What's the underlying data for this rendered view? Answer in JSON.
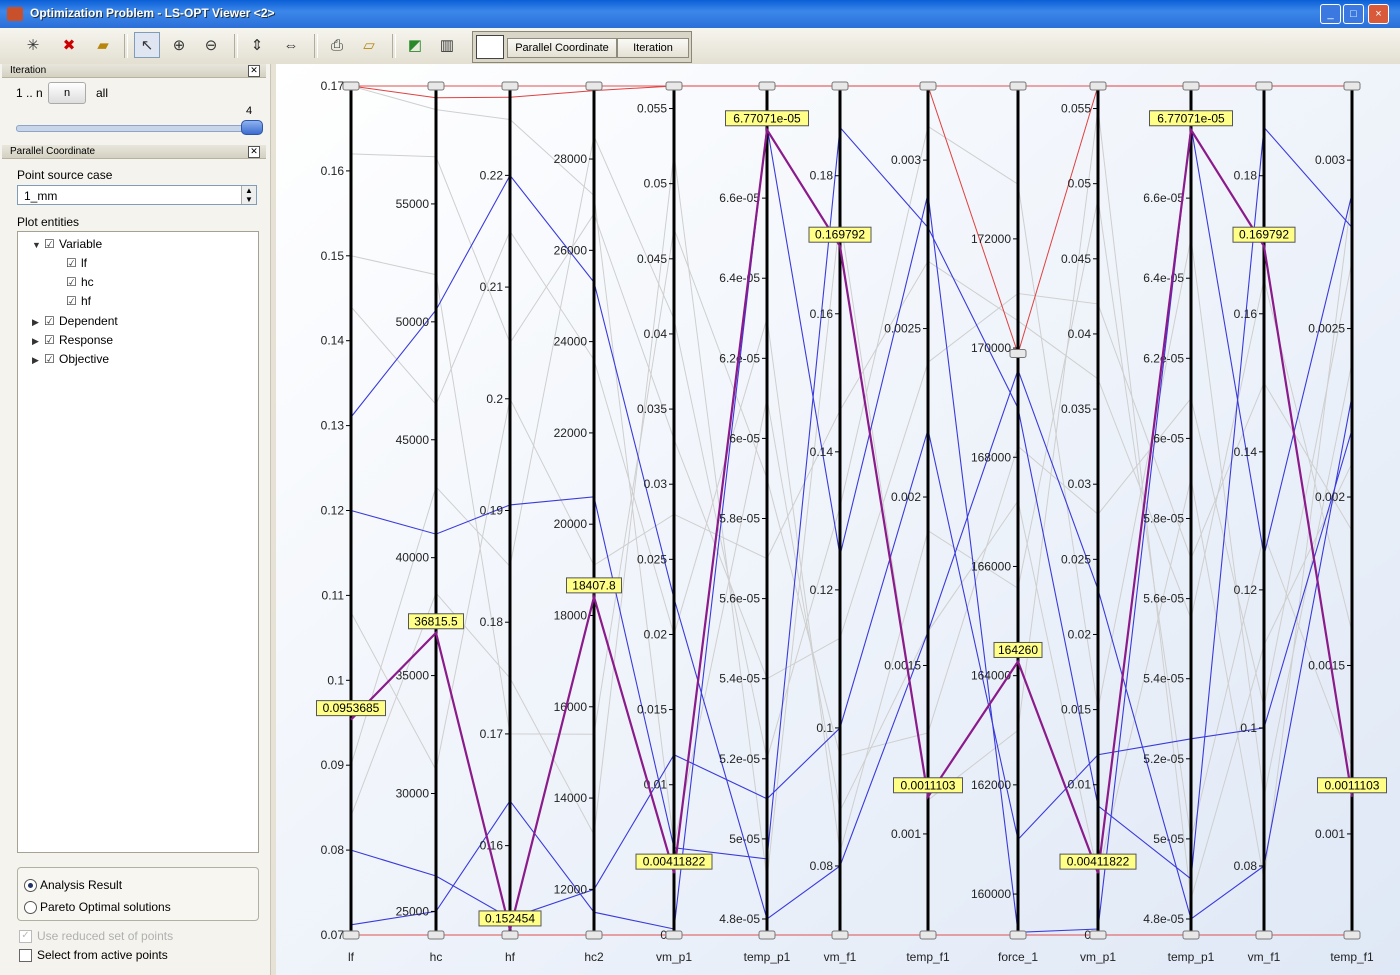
{
  "window": {
    "title": "Optimization Problem - LS-OPT Viewer <2>",
    "buttons": [
      "_",
      "□",
      "×"
    ]
  },
  "toolbar": {
    "icons": [
      "new-plot-icon",
      "delete-plot-icon",
      "open-folder-icon",
      "pointer-icon",
      "zoom-in-icon",
      "zoom-out-icon",
      "expand-vertical-icon",
      "expand-horizontal-icon",
      "print-icon",
      "export-icon",
      "plot-settings-icon",
      "layout-icon"
    ],
    "tabs": [
      "Parallel Coordinate",
      "Iteration"
    ]
  },
  "iteration_panel": {
    "title": "Iteration",
    "range_label": "1 .. n",
    "n_button": "n",
    "all_label": "all",
    "slider_value": "4",
    "slider_fraction": 1.0
  },
  "pc_panel": {
    "title": "Parallel Coordinate",
    "point_source_label": "Point source case",
    "point_source_value": "1_mm",
    "plot_entities_label": "Plot entities",
    "tree": [
      {
        "label": "Variable",
        "expanded": true,
        "checked": true,
        "children": [
          "lf",
          "hc",
          "hf"
        ]
      },
      {
        "label": "Dependent",
        "expanded": false,
        "checked": true
      },
      {
        "label": "Response",
        "expanded": false,
        "checked": true
      },
      {
        "label": "Objective",
        "expanded": false,
        "checked": true
      }
    ],
    "radio_options": [
      "Analysis Result",
      "Pareto Optimal solutions"
    ],
    "radio_selected": 0,
    "checkbox_reduced": "Use reduced set of points",
    "checkbox_active": "Select from active points"
  },
  "colors": {
    "selected": "#8b1a8b",
    "feasible": "#3a3adb",
    "infeasible": "#cfcfcf",
    "highlight": "#e04040",
    "label_bg": "#ffff88"
  },
  "chart_data": {
    "type": "parallel-coordinates",
    "axes": [
      {
        "name": "lf",
        "range": [
          0.07,
          0.17
        ],
        "ticks": [
          "0.07",
          "0.08",
          "0.09",
          "0.1",
          "0.11",
          "0.12",
          "0.13",
          "0.14",
          "0.15",
          "0.16",
          "0.17"
        ]
      },
      {
        "name": "hc",
        "range": [
          24000,
          60000
        ],
        "ticks": [
          "25000",
          "30000",
          "35000",
          "40000",
          "45000",
          "50000",
          "55000"
        ]
      },
      {
        "name": "hf",
        "range": [
          0.152,
          0.228
        ],
        "ticks": [
          "0.16",
          "0.17",
          "0.18",
          "0.19",
          "0.2",
          "0.21",
          "0.22"
        ]
      },
      {
        "name": "hc2",
        "range": [
          11000,
          29600
        ],
        "ticks": [
          "12000",
          "14000",
          "16000",
          "18000",
          "20000",
          "22000",
          "24000",
          "26000",
          "28000"
        ]
      },
      {
        "name": "vm_p1",
        "range": [
          0,
          0.0565
        ],
        "ticks": [
          "0",
          "0.005",
          "0.01",
          "0.015",
          "0.02",
          "0.025",
          "0.03",
          "0.035",
          "0.04",
          "0.045",
          "0.05",
          "0.055"
        ]
      },
      {
        "name": "temp_p1",
        "range": [
          4.76e-05,
          6.88e-05
        ],
        "ticks": [
          "4.8e-05",
          "5e-05",
          "5.2e-05",
          "5.4e-05",
          "5.6e-05",
          "5.8e-05",
          "6e-05",
          "6.2e-05",
          "6.4e-05",
          "6.6e-05"
        ]
      },
      {
        "name": "vm_f1",
        "range": [
          0.07,
          0.193
        ],
        "ticks": [
          "0.08",
          "0.1",
          "0.12",
          "0.14",
          "0.16",
          "0.18"
        ]
      },
      {
        "name": "temp_f1",
        "range": [
          0.0007,
          0.00322
        ],
        "ticks": [
          "0.001",
          "0.0015",
          "0.002",
          "0.0025",
          "0.003"
        ]
      },
      {
        "name": "force_1",
        "range": [
          159250,
          174800
        ],
        "ticks": [
          "160000",
          "162000",
          "164000",
          "166000",
          "168000",
          "170000",
          "172000"
        ]
      },
      {
        "name": "vm_p1",
        "range": [
          0,
          0.0565
        ],
        "ticks": [
          "0",
          "0.005",
          "0.01",
          "0.015",
          "0.02",
          "0.025",
          "0.03",
          "0.035",
          "0.04",
          "0.045",
          "0.05",
          "0.055"
        ]
      },
      {
        "name": "temp_p1",
        "range": [
          4.76e-05,
          6.88e-05
        ],
        "ticks": [
          "4.8e-05",
          "5e-05",
          "5.2e-05",
          "5.4e-05",
          "5.6e-05",
          "5.8e-05",
          "6e-05",
          "6.2e-05",
          "6.4e-05",
          "6.6e-05"
        ]
      },
      {
        "name": "vm_f1",
        "range": [
          0.07,
          0.193
        ],
        "ticks": [
          "0.08",
          "0.1",
          "0.12",
          "0.14",
          "0.16",
          "0.18"
        ]
      },
      {
        "name": "temp_f1",
        "range": [
          0.0007,
          0.00322
        ],
        "ticks": [
          "0.001",
          "0.0015",
          "0.002",
          "0.0025",
          "0.003"
        ]
      }
    ],
    "selected_point": {
      "values": [
        0.0953685,
        36815.5,
        0.152454,
        18407.8,
        0.00411822,
        6.77071e-05,
        0.169792,
        0.0011103,
        164260,
        0.00411822,
        6.77071e-05,
        0.169792,
        0.0011103
      ],
      "labels": [
        "0.0953685",
        "36815.5",
        "0.152454",
        "18407.8",
        "0.00411822",
        "6.77071e-05",
        "0.169792",
        "0.0011103",
        "164260",
        "0.00411822",
        "6.77071e-05",
        "0.169792",
        "0.0011103"
      ]
    },
    "feasible_points": [
      [
        0.12,
        41000,
        0.1905,
        20600,
        0.0058,
        4.95e-05,
        0.187,
        0.0028,
        168900,
        0.0086,
        4.9e-05,
        0.187,
        0.0028
      ],
      [
        0.131,
        50500,
        0.22,
        25300,
        0.0224,
        4.8e-05,
        0.08,
        0.0016,
        169600,
        0.023,
        4.8e-05,
        0.08,
        0.0023
      ],
      [
        0.0712,
        25000,
        0.164,
        11500,
        0.0004,
        6.78e-05,
        0.125,
        0.0029,
        159300,
        0.0004,
        6.78e-05,
        0.125,
        0.0029
      ],
      [
        0.08,
        26500,
        0.1535,
        12000,
        0.012,
        5.1e-05,
        0.1,
        0.0022,
        161000,
        0.012,
        5.25e-05,
        0.1,
        0.0022
      ]
    ],
    "infeasible_points": [
      [
        0.162,
        57000,
        0.205,
        26800,
        0.033,
        5.4e-05,
        0.113,
        0.0024,
        171000,
        0.042,
        5.7e-05,
        0.15,
        0.0019
      ],
      [
        0.15,
        52000,
        0.17,
        15400,
        0.047,
        5.9e-05,
        0.096,
        0.0013,
        168200,
        0.028,
        6.1e-05,
        0.103,
        0.0027
      ],
      [
        0.144,
        46500,
        0.215,
        23600,
        0.02,
        6.3e-05,
        0.082,
        0.0019,
        165600,
        0.049,
        5e-05,
        0.128,
        0.0012
      ],
      [
        0.09,
        43000,
        0.185,
        28500,
        0.041,
        5.2e-05,
        0.132,
        0.0031,
        173000,
        0.015,
        6.5e-05,
        0.09,
        0.0024
      ],
      [
        0.108,
        31000,
        0.2,
        19100,
        0.028,
        5.7e-05,
        0.146,
        0.0027,
        170500,
        0.037,
        5.55e-05,
        0.165,
        0.0016
      ],
      [
        0.084,
        38500,
        0.175,
        13200,
        0.052,
        4.9e-05,
        0.174,
        0.0011,
        163000,
        0.055,
        4.85e-05,
        0.112,
        0.0021
      ],
      [
        0.17,
        59000,
        0.225,
        27200,
        0.006,
        6.1e-05,
        0.088,
        0.0016,
        167200,
        0.004,
        5.9e-05,
        0.078,
        0.0029
      ]
    ],
    "highlight_points": [
      [
        0.17,
        59500,
        0.227,
        29500,
        0.0565,
        6.88e-05,
        0.193,
        0.00322,
        169900,
        0.0565,
        6.88e-05,
        0.193,
        0.00322
      ]
    ]
  }
}
